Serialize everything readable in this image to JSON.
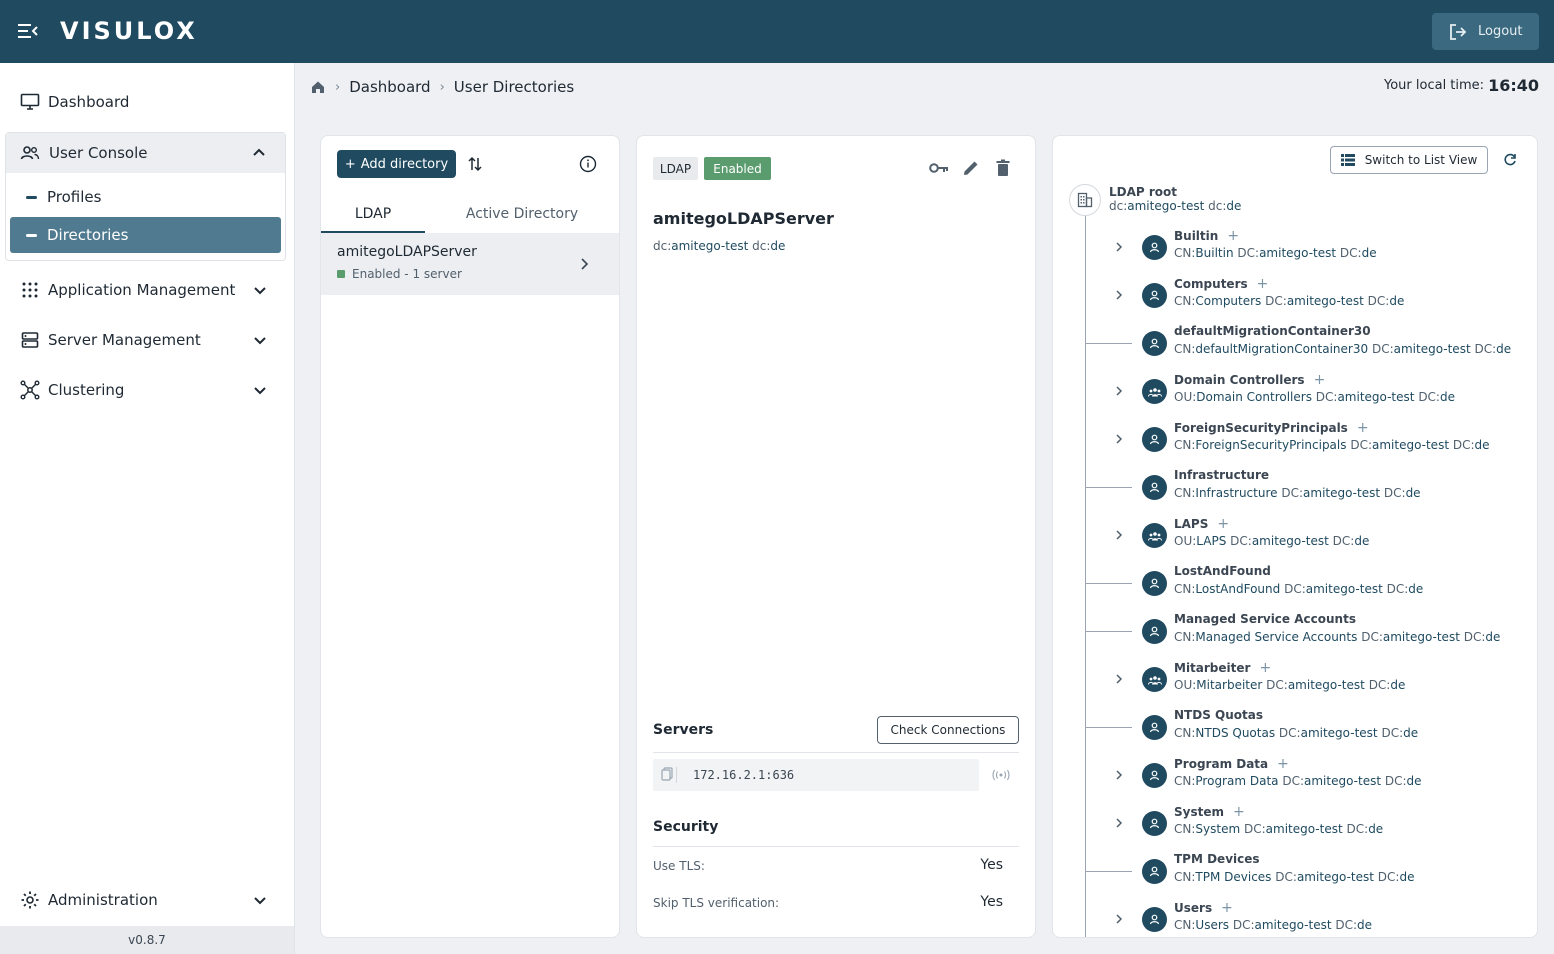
{
  "app": {
    "logo": "VISULOX",
    "logout_label": "Logout",
    "version": "v0.8.7"
  },
  "sidebar": {
    "dashboard": "Dashboard",
    "user_console": "User Console",
    "profiles": "Profiles",
    "directories": "Directories",
    "application_management": "Application Management",
    "server_management": "Server Management",
    "clustering": "Clustering",
    "administration": "Administration"
  },
  "breadcrumb": {
    "items": [
      "Dashboard",
      "User Directories"
    ]
  },
  "localtime": {
    "label": "Your local time:",
    "value": "16:40"
  },
  "directories_panel": {
    "add_label": "Add directory",
    "tabs": [
      "LDAP",
      "Active Directory"
    ],
    "items": [
      {
        "name": "amitegoLDAPServer",
        "status": "Enabled - 1 server"
      }
    ]
  },
  "detail": {
    "type_badge": "LDAP",
    "status_badge": "Enabled",
    "name": "amitegoLDAPServer",
    "dn": [
      {
        "k": "dc:",
        "v": "amitego-test"
      },
      {
        "k": "dc:",
        "v": "de"
      }
    ],
    "servers_title": "Servers",
    "check_label": "Check Connections",
    "server_address": "172.16.2.1:636",
    "security_title": "Security",
    "security": [
      {
        "label": "Use TLS:",
        "value": "Yes"
      },
      {
        "label": "Skip TLS verification:",
        "value": "Yes"
      }
    ]
  },
  "tree": {
    "switch_label": "Switch to List View",
    "root_label": "LDAP root",
    "root_dn": [
      {
        "k": "dc:",
        "v": "amitego-test"
      },
      {
        "k": "dc:",
        "v": "de"
      }
    ],
    "nodes": [
      {
        "name": "Builtin",
        "expandable": true,
        "group": false,
        "dn": [
          {
            "k": "CN:",
            "v": "Builtin"
          },
          {
            "k": "DC:",
            "v": "amitego-test"
          },
          {
            "k": "DC:",
            "v": "de"
          }
        ]
      },
      {
        "name": "Computers",
        "expandable": true,
        "group": false,
        "dn": [
          {
            "k": "CN:",
            "v": "Computers"
          },
          {
            "k": "DC:",
            "v": "amitego-test"
          },
          {
            "k": "DC:",
            "v": "de"
          }
        ]
      },
      {
        "name": "defaultMigrationContainer30",
        "expandable": false,
        "group": false,
        "dn": [
          {
            "k": "CN:",
            "v": "defaultMigrationContainer30"
          },
          {
            "k": "DC:",
            "v": "amitego-test"
          },
          {
            "k": "DC:",
            "v": "de"
          }
        ]
      },
      {
        "name": "Domain Controllers",
        "expandable": true,
        "group": true,
        "dn": [
          {
            "k": "OU:",
            "v": "Domain Controllers"
          },
          {
            "k": "DC:",
            "v": "amitego-test"
          },
          {
            "k": "DC:",
            "v": "de"
          }
        ]
      },
      {
        "name": "ForeignSecurityPrincipals",
        "expandable": true,
        "group": false,
        "dn": [
          {
            "k": "CN:",
            "v": "ForeignSecurityPrincipals"
          },
          {
            "k": "DC:",
            "v": "amitego-test"
          },
          {
            "k": "DC:",
            "v": "de"
          }
        ]
      },
      {
        "name": "Infrastructure",
        "expandable": false,
        "group": false,
        "dn": [
          {
            "k": "CN:",
            "v": "Infrastructure"
          },
          {
            "k": "DC:",
            "v": "amitego-test"
          },
          {
            "k": "DC:",
            "v": "de"
          }
        ]
      },
      {
        "name": "LAPS",
        "expandable": true,
        "group": true,
        "dn": [
          {
            "k": "OU:",
            "v": "LAPS"
          },
          {
            "k": "DC:",
            "v": "amitego-test"
          },
          {
            "k": "DC:",
            "v": "de"
          }
        ]
      },
      {
        "name": "LostAndFound",
        "expandable": false,
        "group": false,
        "dn": [
          {
            "k": "CN:",
            "v": "LostAndFound"
          },
          {
            "k": "DC:",
            "v": "amitego-test"
          },
          {
            "k": "DC:",
            "v": "de"
          }
        ]
      },
      {
        "name": "Managed Service Accounts",
        "expandable": false,
        "group": false,
        "dn": [
          {
            "k": "CN:",
            "v": "Managed Service Accounts"
          },
          {
            "k": "DC:",
            "v": "amitego-test"
          },
          {
            "k": "DC:",
            "v": "de"
          }
        ]
      },
      {
        "name": "Mitarbeiter",
        "expandable": true,
        "group": true,
        "dn": [
          {
            "k": "OU:",
            "v": "Mitarbeiter"
          },
          {
            "k": "DC:",
            "v": "amitego-test"
          },
          {
            "k": "DC:",
            "v": "de"
          }
        ]
      },
      {
        "name": "NTDS Quotas",
        "expandable": false,
        "group": false,
        "dn": [
          {
            "k": "CN:",
            "v": "NTDS Quotas"
          },
          {
            "k": "DC:",
            "v": "amitego-test"
          },
          {
            "k": "DC:",
            "v": "de"
          }
        ]
      },
      {
        "name": "Program Data",
        "expandable": true,
        "group": false,
        "dn": [
          {
            "k": "CN:",
            "v": "Program Data"
          },
          {
            "k": "DC:",
            "v": "amitego-test"
          },
          {
            "k": "DC:",
            "v": "de"
          }
        ]
      },
      {
        "name": "System",
        "expandable": true,
        "group": false,
        "dn": [
          {
            "k": "CN:",
            "v": "System"
          },
          {
            "k": "DC:",
            "v": "amitego-test"
          },
          {
            "k": "DC:",
            "v": "de"
          }
        ]
      },
      {
        "name": "TPM Devices",
        "expandable": false,
        "group": false,
        "dn": [
          {
            "k": "CN:",
            "v": "TPM Devices"
          },
          {
            "k": "DC:",
            "v": "amitego-test"
          },
          {
            "k": "DC:",
            "v": "de"
          }
        ]
      },
      {
        "name": "Users",
        "expandable": true,
        "group": false,
        "dn": [
          {
            "k": "CN:",
            "v": "Users"
          },
          {
            "k": "DC:",
            "v": "amitego-test"
          },
          {
            "k": "DC:",
            "v": "de"
          }
        ]
      }
    ]
  }
}
